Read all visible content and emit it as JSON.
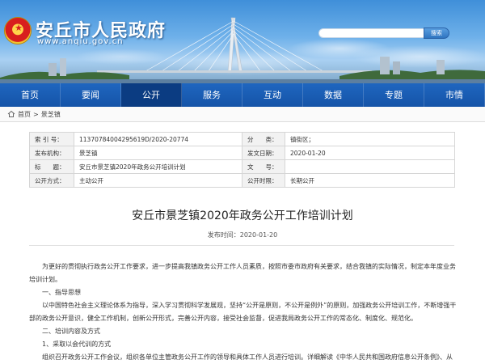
{
  "header": {
    "site_title": "安丘市人民政府",
    "site_url": "www.anqiu.gov.cn",
    "search_placeholder": "",
    "search_button": "搜索"
  },
  "nav": {
    "items": [
      "首页",
      "要闻",
      "公开",
      "服务",
      "互动",
      "数据",
      "专题",
      "市情"
    ],
    "active": "公开"
  },
  "breadcrumb": {
    "home": "首页",
    "separator": ">",
    "current": "景芝镇"
  },
  "info": {
    "index_label": "索 引 号：",
    "index_value": "11370784004295619D/2020-20774",
    "category_label": "分　　类：",
    "category_value": "镇街区；",
    "publisher_label": "发布机构：",
    "publisher_value": "景芝镇",
    "date_label": "发文日期：",
    "date_value": "2020-01-20",
    "title_label": "标　　题：",
    "title_value": "安丘市景芝镇2020年政务公开培训计划",
    "docno_label": "文　　号：",
    "docno_value": "",
    "method_label": "公开方式：",
    "method_value": "主动公开",
    "period_label": "公开时限：",
    "period_value": "长期公开"
  },
  "article": {
    "title": "安丘市景芝镇2020年政务公开工作培训计划",
    "date": "发布时间：2020-01-20",
    "p1": "为更好的贯彻执行政务公开工作要求，进一步提高我镇政务公开工作人员素质，按照市委市政府有关要求，结合我镇的实际情况，制定本年度业务培训计划。",
    "h1": "一、指导思想",
    "p2": "以中国特色社会主义理论体系为指导，深入学习贯彻科学发展观，坚持“公开是原则，不公开是例外”的原则，加强政务公开培训工作，不断增强干部的政务公开意识，健全工作机制，创新公开形式，完善公开内容，接受社会监督，促进我局政务公开工作的常态化、制度化、规范化。",
    "h2": "二、培训内容及方式",
    "h3": "1、采取以会代训的方式",
    "p3": "组织召开政务公开工作会议，组织各单位主管政务公开工作的领导和具体工作人员进行培训。详细解读《中华人民共和国政府信息公开条例》、从《条例》出台的背景、重要意义，以及公开政府信息的原则、内容和要求、公开政府信息是各级行政机关的职能和义务，从而提高公"
  }
}
